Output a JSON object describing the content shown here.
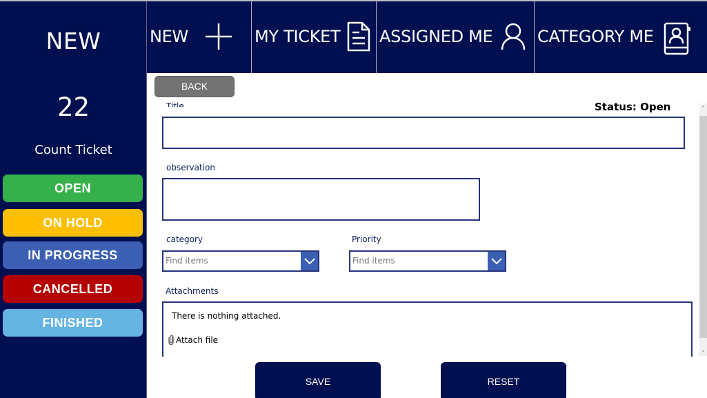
{
  "sidebar": {
    "title": "NEW",
    "count": "22",
    "count_label": "Count Ticket",
    "status_buttons": [
      {
        "label": "OPEN",
        "color": "#36b04b"
      },
      {
        "label": "ON HOLD",
        "color": "#fdbf00"
      },
      {
        "label": "IN PROGRESS",
        "color": "#3a5fb3"
      },
      {
        "label": "CANCELLED",
        "color": "#b50000"
      },
      {
        "label": "FINISHED",
        "color": "#65b4e2"
      }
    ]
  },
  "nav": {
    "items": [
      {
        "label": "NEW",
        "icon": "plus-icon"
      },
      {
        "label": "MY TICKET",
        "icon": "document-icon"
      },
      {
        "label": "ASSIGNED ME",
        "icon": "person-icon"
      },
      {
        "label": "CATEGORY ME",
        "icon": "contact-book-icon"
      }
    ]
  },
  "form": {
    "back_label": "BACK",
    "status_text": "Status: Open",
    "title_label": "Title",
    "title_value": "",
    "observation_label": "observation",
    "observation_value": "",
    "category_label": "category",
    "category_placeholder": "Find items",
    "priority_label": "Priority",
    "priority_placeholder": "Find items",
    "attachments_label": "Attachments",
    "attachments_empty": "There is nothing attached.",
    "attach_file_label": "Attach file",
    "save_label": "SAVE",
    "reset_label": "RESET"
  },
  "colors": {
    "primary_navy": "#000f4f",
    "dropdown_accent": "#3a5fb3",
    "back_button": "#737373"
  }
}
